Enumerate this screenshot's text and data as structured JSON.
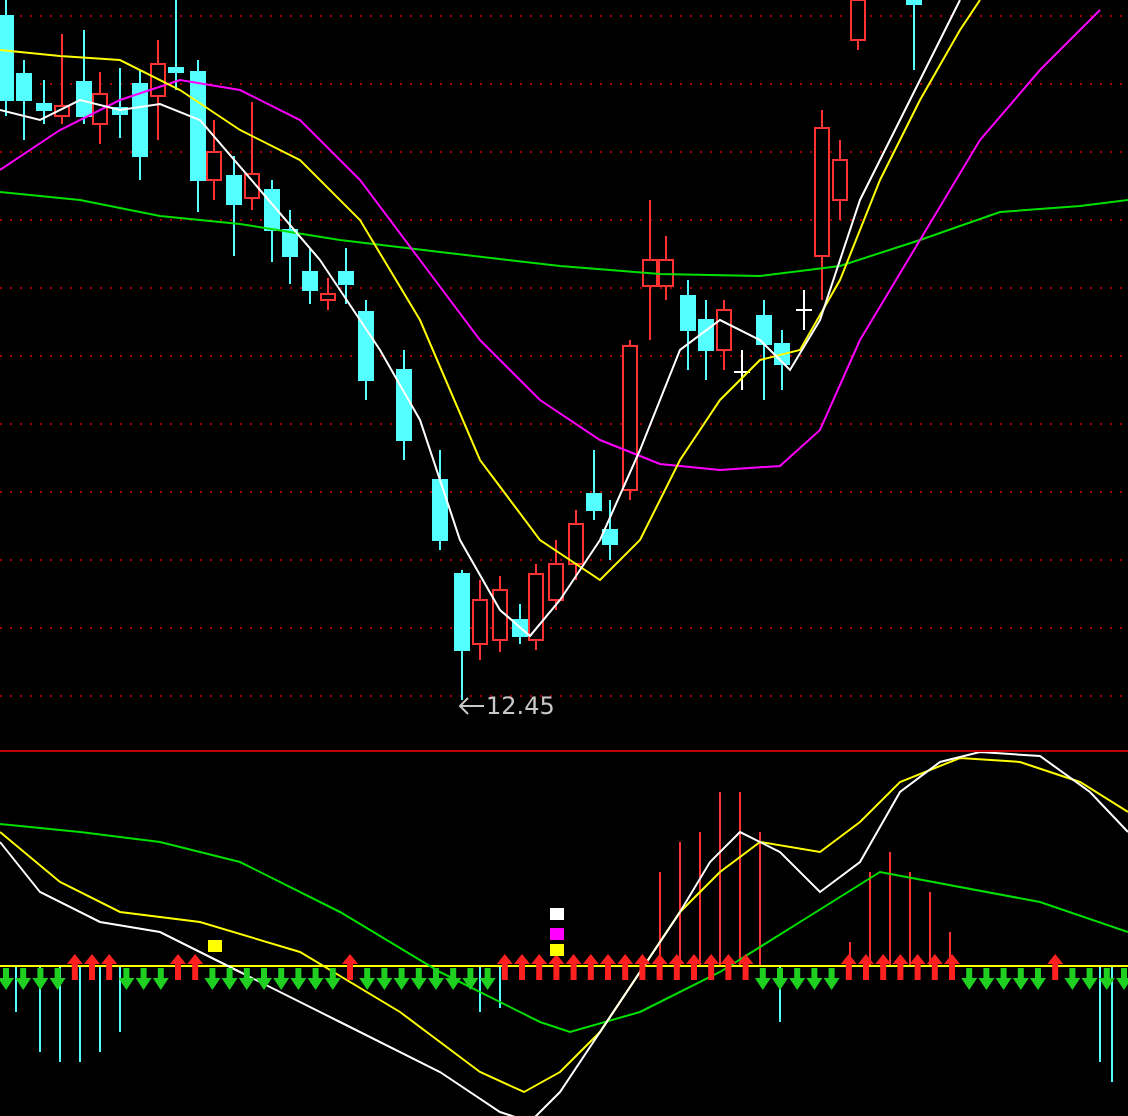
{
  "price_panel": {
    "low_marker": {
      "label": "12.45"
    }
  }
}
